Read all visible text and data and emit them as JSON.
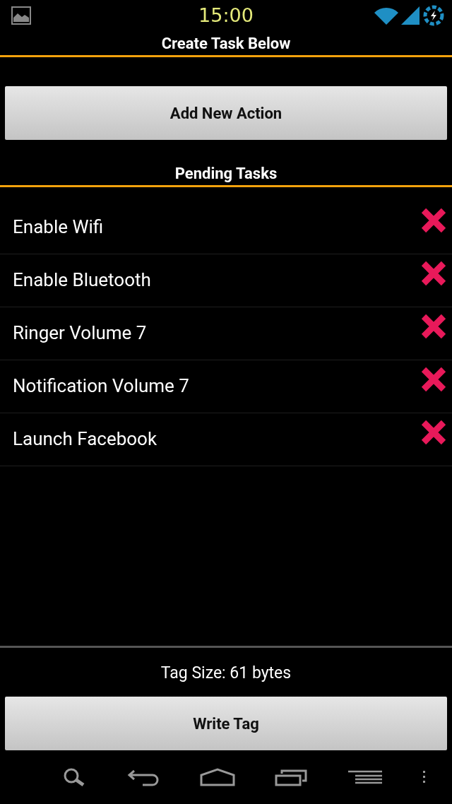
{
  "status_bar": {
    "time": "15:00"
  },
  "header": {
    "title": "Create Task Below"
  },
  "add_button": {
    "label": "Add New Action"
  },
  "pending": {
    "title": "Pending Tasks",
    "tasks": [
      {
        "label": "Enable Wifi"
      },
      {
        "label": "Enable Bluetooth"
      },
      {
        "label": "Ringer Volume 7"
      },
      {
        "label": "Notification Volume 7"
      },
      {
        "label": "Launch Facebook"
      }
    ]
  },
  "footer": {
    "size_text": "Tag Size: 61 bytes",
    "write_button": {
      "label": "Write Tag"
    }
  }
}
